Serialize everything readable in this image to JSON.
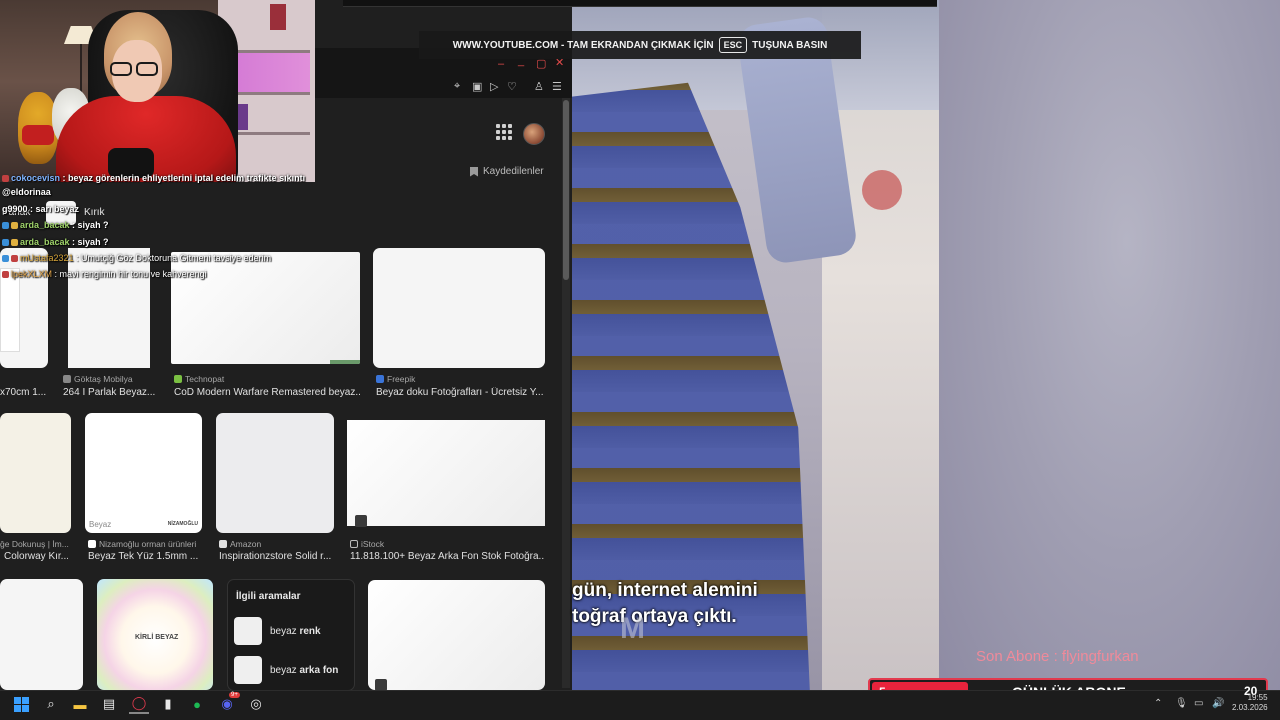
{
  "youtube": {
    "fullscreen_banner_prefix": "WWW.YOUTUBE.COM - TAM EKRANDAN ÇIKMAK İÇİN",
    "fullscreen_banner_key": "ESC",
    "fullscreen_banner_suffix": "TUŞUNA BASIN"
  },
  "search_page": {
    "saved_label": "Kaydedilenler",
    "chips": [
      "Parlak",
      "Kırık"
    ],
    "results": [
      {
        "source": "",
        "title": "x70cm 1..."
      },
      {
        "source": "Göktaş Mobilya",
        "title": "264 I Parlak Beyaz..."
      },
      {
        "source": "Technopat",
        "title": "CoD Modern Warfare Remastered beyaz..."
      },
      {
        "source": "Freepik",
        "title": "Beyaz doku Fotoğrafları - Ücretsiz Y..."
      },
      {
        "source": "ğe Dokunuş | İm...",
        "title": "Colorway Kır..."
      },
      {
        "source": "Nizamoğlu orman ürünleri",
        "title": "Beyaz Tek Yüz 1.5mm ..."
      },
      {
        "source": "Amazon",
        "title": "Inspirationzstore Solid r..."
      },
      {
        "source": "iStock",
        "title": "11.818.100+ Beyaz Arka Fon Stok Fotoğra..."
      }
    ],
    "thumb_texts": {
      "beyaz": "Beyaz",
      "nizamoglu": "NİZAMOĞLU",
      "kirli": "KİRLİ BEYAZ"
    },
    "related": {
      "title": "İlgili aramalar",
      "items": [
        {
          "prefix": "beyaz ",
          "bold": "renk"
        },
        {
          "prefix": "beyaz ",
          "bold": "arka fon"
        }
      ]
    }
  },
  "chat": {
    "messages": [
      {
        "user": "",
        "text": "beyaz görenlerin ehliyetlerini iptal edelim trafikte sıkıntı"
      },
      {
        "user": "@eldorinaa",
        "text": ""
      },
      {
        "user": "g9900",
        "text": "sarı beyaz"
      },
      {
        "user": "arda_bacak",
        "text": "siyah ?"
      },
      {
        "user": "arda_bacak",
        "text": "siyah ?"
      },
      {
        "user": "mUstafa2321",
        "text": "Umutçiğ Göz Doktoruna Gitmeni tavsiye ederim"
      },
      {
        "user": "lpekXLXM",
        "text": "mavi rengimin hir tonu ve kahverengi"
      }
    ]
  },
  "video": {
    "subtitle_line1": "gün, internet alemini",
    "subtitle_line2": "toğraf ortaya çıktı.",
    "watermark": "M"
  },
  "overlay": {
    "last_sub_label": "Son Abone : flyingfurkan",
    "sub_count": "5",
    "daily_label": "GÜNLÜK ABONE",
    "corner_number": "20"
  },
  "taskbar": {
    "time": "19:55",
    "date": "2.03.2026",
    "discord_badge": "9+"
  },
  "colors": {
    "accent_red": "#e23a4e",
    "windows_blue": "#3aa0ff"
  }
}
